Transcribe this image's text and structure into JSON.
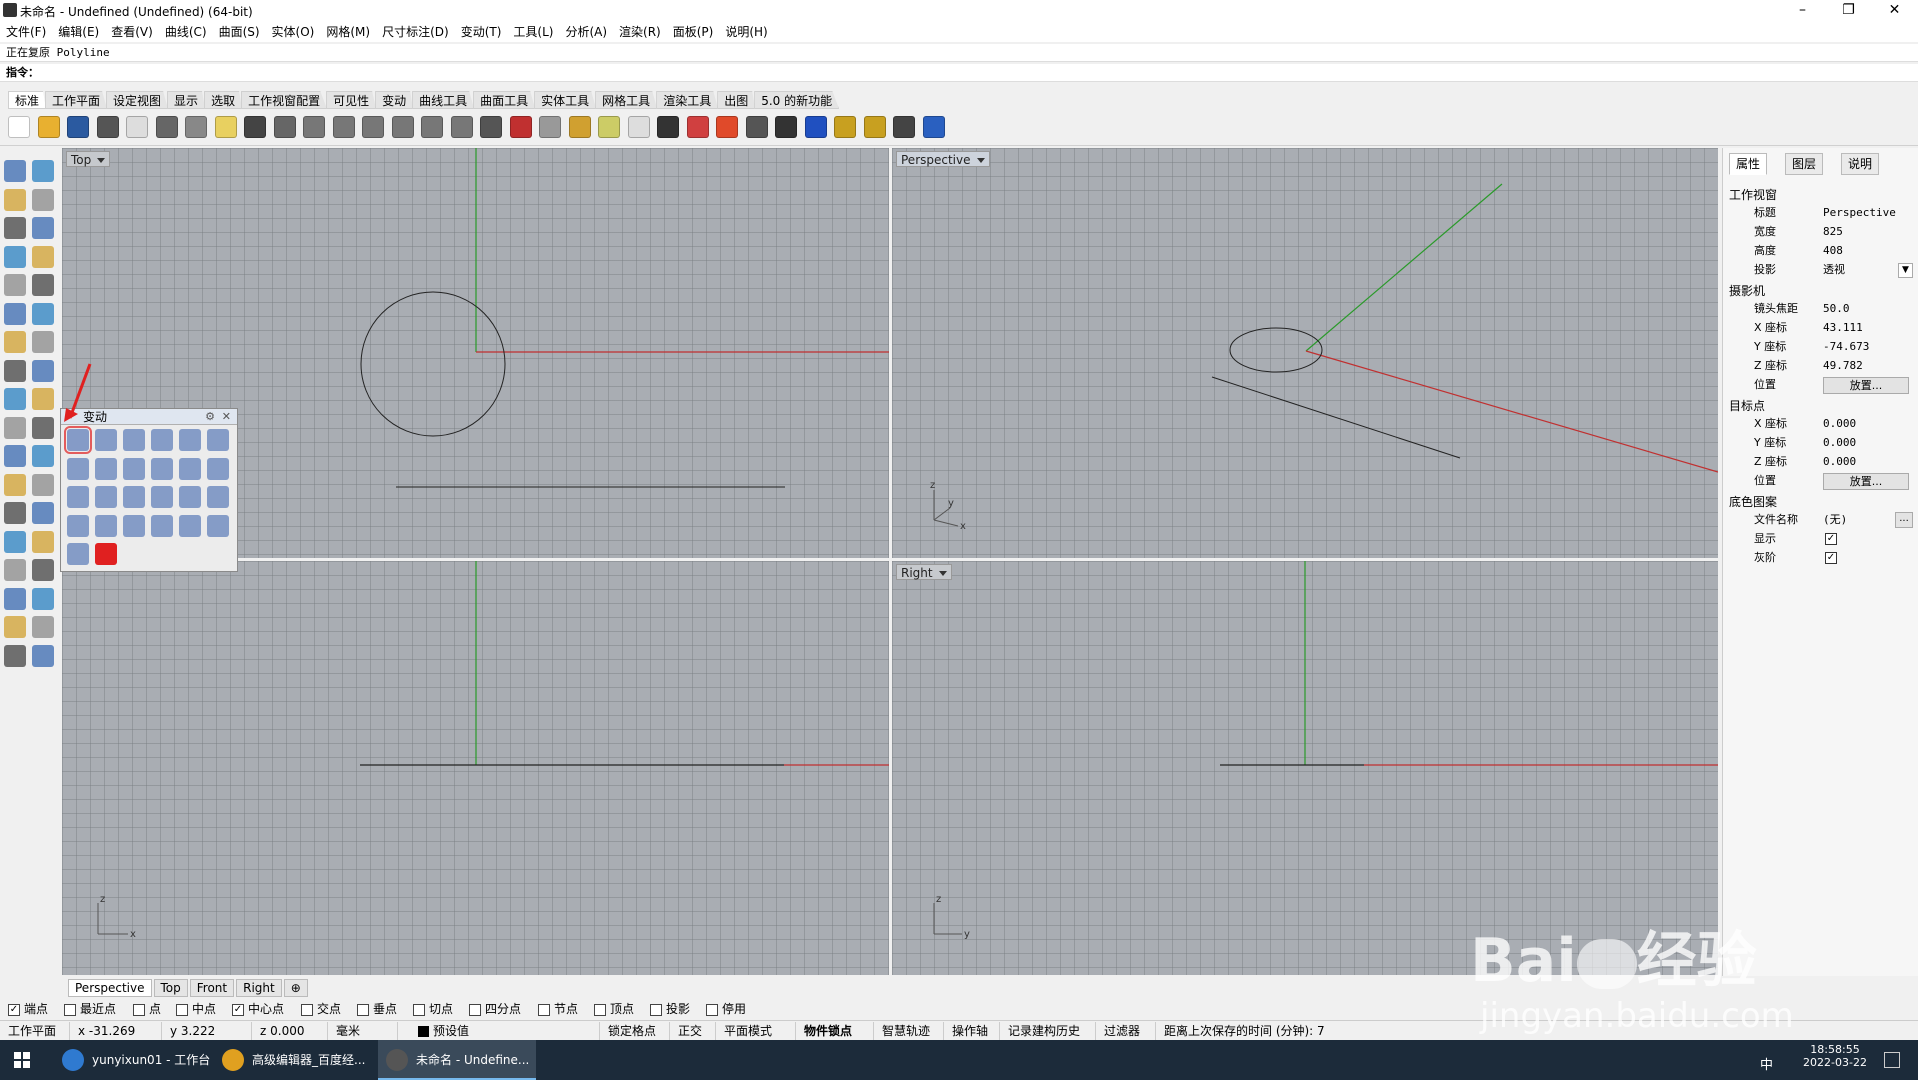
{
  "window": {
    "title": "未命名 - Undefined (Undefined) (64-bit)",
    "minimize": "–",
    "maximize": "❐",
    "close": "✕"
  },
  "menu": [
    "文件(F)",
    "编辑(E)",
    "查看(V)",
    "曲线(C)",
    "曲面(S)",
    "实体(O)",
    "网格(M)",
    "尺寸标注(D)",
    "变动(T)",
    "工具(L)",
    "分析(A)",
    "渲染(R)",
    "面板(P)",
    "说明(H)"
  ],
  "command": {
    "history": "正在复原 Polyline",
    "prompt": "指令："
  },
  "toolbar_tabs": [
    "标准",
    "工作平面",
    "设定视图",
    "显示",
    "选取",
    "工作视窗配置",
    "可见性",
    "变动",
    "曲线工具",
    "曲面工具",
    "实体工具",
    "网格工具",
    "渲染工具",
    "出图",
    "5.0 的新功能"
  ],
  "viewports": {
    "top": {
      "label": "Top"
    },
    "perspective": {
      "label": "Perspective"
    },
    "front": {
      "label": ""
    },
    "right": {
      "label": "Right"
    }
  },
  "axis_labels": {
    "persp": [
      "z",
      "y",
      "x"
    ],
    "front": [
      "z",
      "x"
    ],
    "right": [
      "z",
      "y"
    ]
  },
  "palette": {
    "title": "变动"
  },
  "panel": {
    "tabs": [
      "属性",
      "图层",
      "说明"
    ],
    "section_viewport": "工作视窗",
    "rows_viewport": [
      {
        "k": "标题",
        "v": "Perspective"
      },
      {
        "k": "宽度",
        "v": "825"
      },
      {
        "k": "高度",
        "v": "408"
      },
      {
        "k": "投影",
        "v": "透视"
      }
    ],
    "section_camera": "摄影机",
    "rows_camera": [
      {
        "k": "镜头焦距",
        "v": "50.0"
      },
      {
        "k": "X 座标",
        "v": "43.111"
      },
      {
        "k": "Y 座标",
        "v": "-74.673"
      },
      {
        "k": "Z 座标",
        "v": "49.782"
      }
    ],
    "position_label": "位置",
    "place_button": "放置...",
    "section_target": "目标点",
    "rows_target": [
      {
        "k": "X 座标",
        "v": "0.000"
      },
      {
        "k": "Y 座标",
        "v": "0.000"
      },
      {
        "k": "Z 座标",
        "v": "0.000"
      }
    ],
    "section_bg": "底色图案",
    "file_label": "文件名称",
    "file_value": "(无)",
    "file_btn": "...",
    "show_label": "显示",
    "gray_label": "灰阶"
  },
  "viewport_tabs": [
    "Perspective",
    "Top",
    "Front",
    "Right",
    "⊕"
  ],
  "osnaps": [
    {
      "label": "端点",
      "checked": true
    },
    {
      "label": "最近点",
      "checked": false
    },
    {
      "label": "点",
      "checked": false
    },
    {
      "label": "中点",
      "checked": false
    },
    {
      "label": "中心点",
      "checked": true
    },
    {
      "label": "交点",
      "checked": false
    },
    {
      "label": "垂点",
      "checked": false
    },
    {
      "label": "切点",
      "checked": false
    },
    {
      "label": "四分点",
      "checked": false
    },
    {
      "label": "节点",
      "checked": false
    },
    {
      "label": "顶点",
      "checked": false
    },
    {
      "label": "投影",
      "checked": false
    },
    {
      "label": "停用",
      "checked": false
    }
  ],
  "status": {
    "cplane": "工作平面",
    "x": "x -31.269",
    "y": "y 3.222",
    "z": "z 0.000",
    "unit": "毫米",
    "layer": "预设值",
    "items": [
      "锁定格点",
      "正交",
      "平面模式",
      "物件锁点",
      "智慧轨迹",
      "操作轴",
      "记录建构历史",
      "过滤器"
    ],
    "save_time": "距离上次保存的时间 (分钟): 7"
  },
  "taskbar": {
    "apps": [
      "yunyixun01 - 工作台",
      "高级编辑器_百度经...",
      "未命名 - Undefine..."
    ],
    "time": "18:58:55",
    "date": "2022-03-22",
    "ime": "中"
  },
  "watermark": {
    "brand": "Bai",
    "suffix": "经验",
    "url": "jingyan.baidu.com"
  },
  "colors": {
    "x_axis": "#c03030",
    "y_axis": "#2a9a2a",
    "highlight": "#e02020",
    "grid_bg": "#a9adb3"
  }
}
